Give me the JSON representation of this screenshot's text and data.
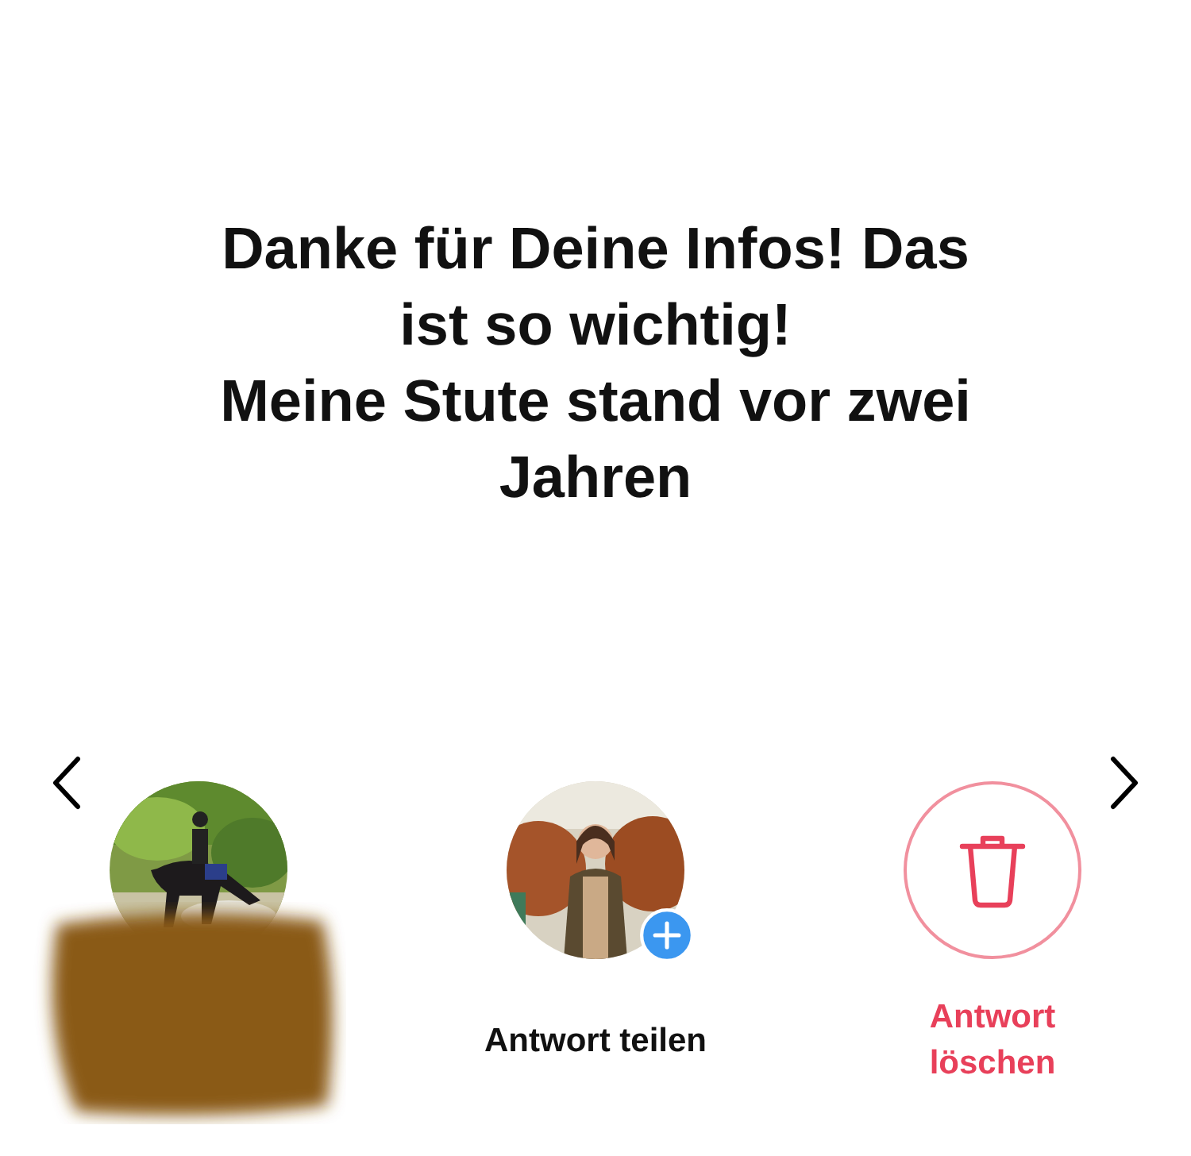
{
  "message": "Danke für Deine Infos! Das ist so wichtig!\nMeine Stute stand vor zwei Jahren",
  "actions": [
    {
      "kind": "profile",
      "redacted": true,
      "add_badge": false
    },
    {
      "kind": "profile",
      "label": "Antwort teilen",
      "redacted": false,
      "add_badge": true
    },
    {
      "kind": "delete",
      "label": "Antwort löschen"
    }
  ]
}
